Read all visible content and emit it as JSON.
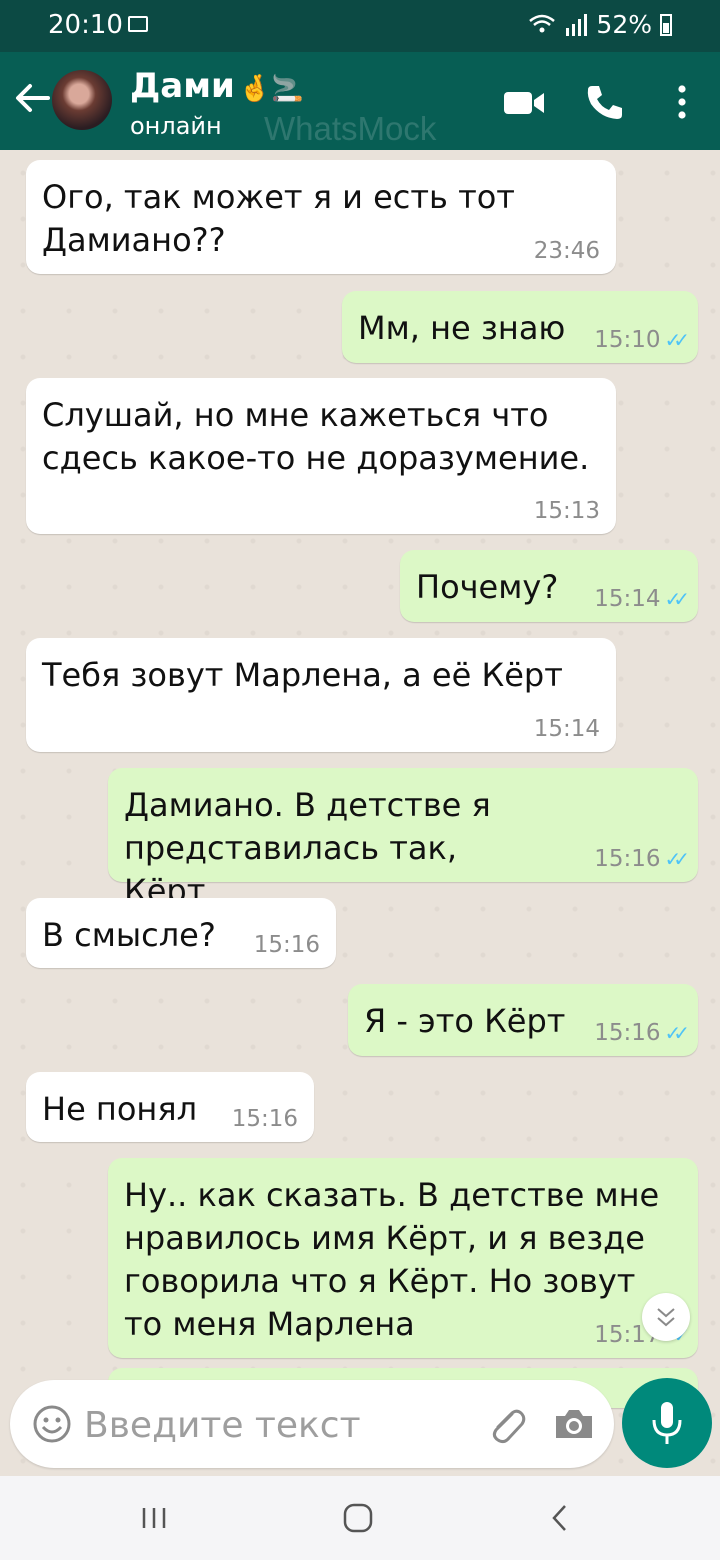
{
  "status_bar": {
    "time": "20:10",
    "battery": "52%"
  },
  "header": {
    "contact_name": "Дами",
    "contact_emoji": "🤞🚬",
    "status": "онлайн",
    "watermark": "WhatsMock"
  },
  "messages": [
    {
      "dir": "in",
      "text": "Ого, так может я и есть тот Дамиано??",
      "time": "23:46"
    },
    {
      "dir": "out",
      "text": "Мм, не знаю",
      "time": "15:10",
      "read": true
    },
    {
      "dir": "in",
      "text": "Слушай, но мне кажеться что сдесь какое-то не доразумение.",
      "time": "15:13"
    },
    {
      "dir": "out",
      "text": "Почему?",
      "time": "15:14",
      "read": true
    },
    {
      "dir": "in",
      "text": "Тебя зовут Марлена, а её Кёрт",
      "time": "15:14"
    },
    {
      "dir": "out",
      "text": "Дамиано. В детстве я представилась так, Кёрт",
      "time": "15:16",
      "read": true
    },
    {
      "dir": "in",
      "text": "В смысле?",
      "time": "15:16"
    },
    {
      "dir": "out",
      "text": "Я - это Кёрт",
      "time": "15:16",
      "read": true
    },
    {
      "dir": "in",
      "text": "Не понял",
      "time": "15:16"
    },
    {
      "dir": "out",
      "text": "Ну.. как сказать. В детстве мне нравилось имя Кёрт, и я везде говорила что я Кёрт. Но зовут то меня Марлена",
      "time": "15:17",
      "read": true
    }
  ],
  "input": {
    "placeholder": "Введите текст",
    "value": ""
  },
  "icons": {
    "back": "arrow-left-icon",
    "video": "video-call-icon",
    "call": "phone-icon",
    "menu": "more-vertical-icon",
    "emoji": "emoji-icon",
    "attach": "paperclip-icon",
    "camera": "camera-icon",
    "mic": "microphone-icon",
    "scroll": "chevron-double-down-icon"
  },
  "colors": {
    "header": "#075e54",
    "status_bar": "#0c4a44",
    "outgoing": "#dcf8c6",
    "incoming": "#ffffff",
    "read_tick": "#4fc3f7",
    "mic": "#00897b"
  }
}
